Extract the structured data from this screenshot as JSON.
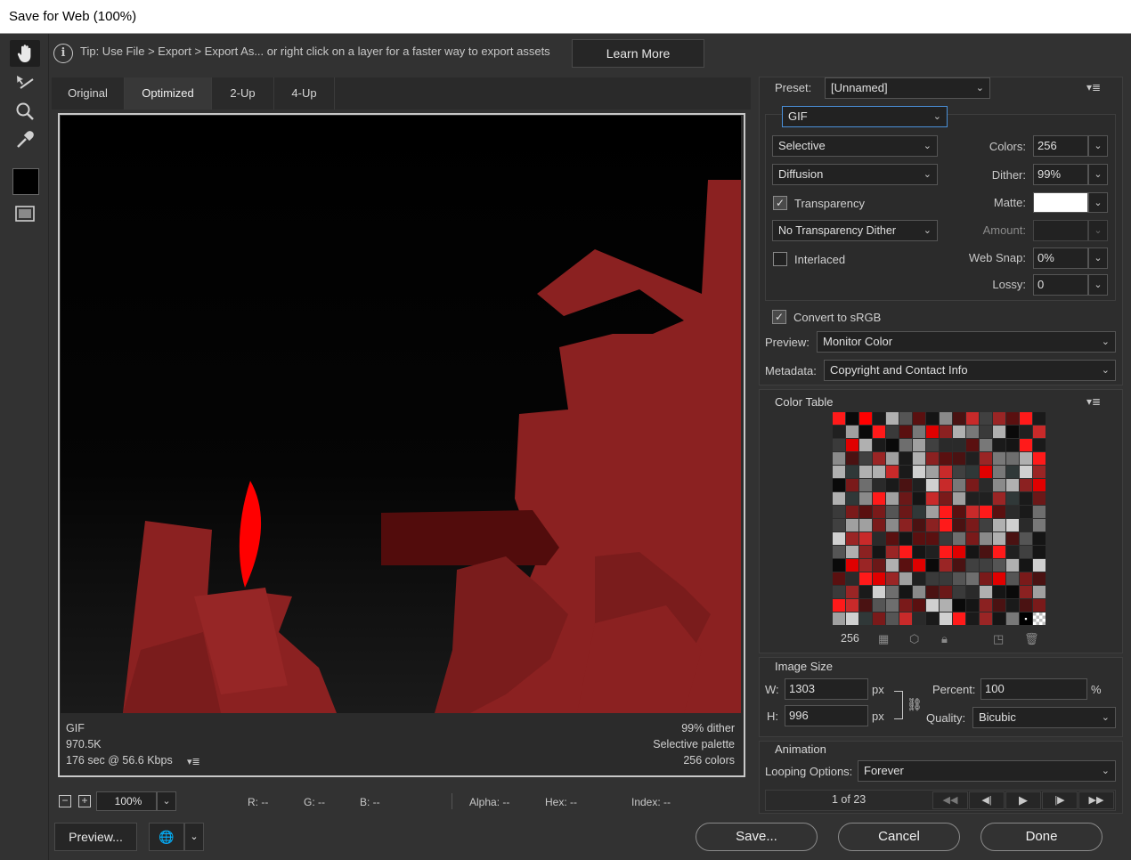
{
  "window": {
    "title": "Save for Web (100%)"
  },
  "tip": {
    "text": "Tip: Use File > Export > Export As...  or right click on a layer for a faster way to export assets",
    "learn_more": "Learn More"
  },
  "tabs": [
    "Original",
    "Optimized",
    "2-Up",
    "4-Up"
  ],
  "image_info": {
    "format": "GIF",
    "size": "970.5K",
    "time": "176 sec @ 56.6 Kbps",
    "dither": "99% dither",
    "palette": "Selective palette",
    "colors": "256 colors"
  },
  "status": {
    "zoom": "100%",
    "r": "R: --",
    "g": "G: --",
    "b": "B: --",
    "alpha": "Alpha: --",
    "hex": "Hex: --",
    "index": "Index: --"
  },
  "buttons": {
    "preview": "Preview...",
    "save": "Save...",
    "cancel": "Cancel",
    "done": "Done"
  },
  "settings": {
    "preset_label": "Preset:",
    "preset": "[Unnamed]",
    "format": "GIF",
    "reduction": "Selective",
    "dither_algo": "Diffusion",
    "transparency_label": "Transparency",
    "transparency_dither": "No Transparency Dither",
    "interlaced_label": "Interlaced",
    "colors_label": "Colors:",
    "colors": "256",
    "dither_label": "Dither:",
    "dither": "99%",
    "matte_label": "Matte:",
    "amount_label": "Amount:",
    "websnap_label": "Web Snap:",
    "websnap": "0%",
    "lossy_label": "Lossy:",
    "lossy": "0",
    "convert_srgb_label": "Convert to sRGB",
    "preview_label": "Preview:",
    "preview": "Monitor Color",
    "metadata_label": "Metadata:",
    "metadata": "Copyright and Contact Info"
  },
  "color_table": {
    "title": "Color Table",
    "count": "256"
  },
  "image_size": {
    "title": "Image Size",
    "w_label": "W:",
    "w": "1303",
    "h_label": "H:",
    "h": "996",
    "px": "px",
    "percent_label": "Percent:",
    "percent": "100",
    "percent_unit": "%",
    "quality_label": "Quality:",
    "quality": "Bicubic"
  },
  "animation": {
    "title": "Animation",
    "looping_label": "Looping Options:",
    "looping": "Forever",
    "frame": "1 of 23"
  },
  "colors_theme": {
    "accent_blue": "#4a90d9",
    "red_dark": "#8b2020",
    "red_bright": "#ff0000"
  }
}
